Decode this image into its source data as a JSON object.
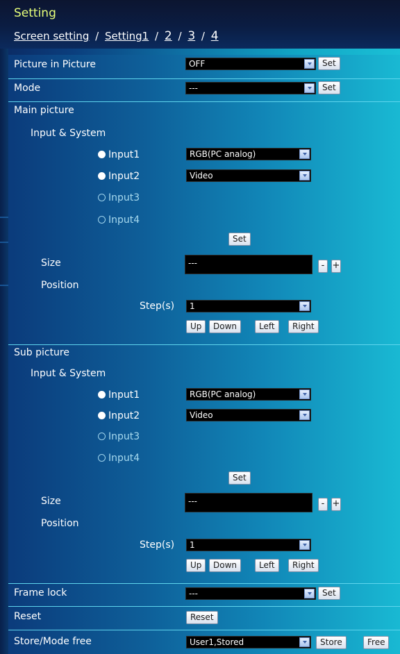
{
  "header": {
    "title": "Setting",
    "breadcrumb": {
      "screen_setting": "Screen setting",
      "sep1": "/",
      "setting1": "Setting1",
      "sep2": "/",
      "current": "2",
      "sep3": "/",
      "page3": "3",
      "sep4": "/",
      "page4": "4"
    }
  },
  "rows": {
    "pip": {
      "label": "Picture in Picture",
      "value": "OFF",
      "set": "Set"
    },
    "mode": {
      "label": "Mode",
      "value": "---",
      "set": "Set"
    },
    "frame_lock": {
      "label": "Frame lock",
      "value": "---",
      "set": "Set"
    },
    "reset": {
      "label": "Reset",
      "button": "Reset"
    },
    "store": {
      "label": "Store/Mode free",
      "value": "User1,Stored",
      "store_btn": "Store",
      "free_btn": "Free"
    }
  },
  "main": {
    "title": "Main picture",
    "input_system": "Input & System",
    "inputs": [
      {
        "label": "Input1",
        "value": "RGB(PC analog)",
        "checked": true
      },
      {
        "label": "Input2",
        "value": "Video",
        "checked": true
      },
      {
        "label": "Input3",
        "checked": false
      },
      {
        "label": "Input4",
        "checked": false
      }
    ],
    "set": "Set",
    "size_label": "Size",
    "size_value": "---",
    "minus": "-",
    "plus": "+",
    "position_label": "Position",
    "steps_label": "Step(s)",
    "steps_value": "1",
    "up": "Up",
    "down": "Down",
    "left": "Left",
    "right": "Right"
  },
  "sub": {
    "title": "Sub picture",
    "input_system": "Input & System",
    "inputs": [
      {
        "label": "Input1",
        "value": "RGB(PC analog)",
        "checked": true
      },
      {
        "label": "Input2",
        "value": "Video",
        "checked": true
      },
      {
        "label": "Input3",
        "checked": false
      },
      {
        "label": "Input4",
        "checked": false
      }
    ],
    "set": "Set",
    "size_label": "Size",
    "size_value": "---",
    "minus": "-",
    "plus": "+",
    "position_label": "Position",
    "steps_label": "Step(s)",
    "steps_value": "1",
    "up": "Up",
    "down": "Down",
    "left": "Left",
    "right": "Right"
  },
  "colors": {
    "title": "#e7ff7a",
    "dropdown_bg": "#000000",
    "panel_left": "#0b3b7b",
    "panel_right": "#19b9d3"
  }
}
